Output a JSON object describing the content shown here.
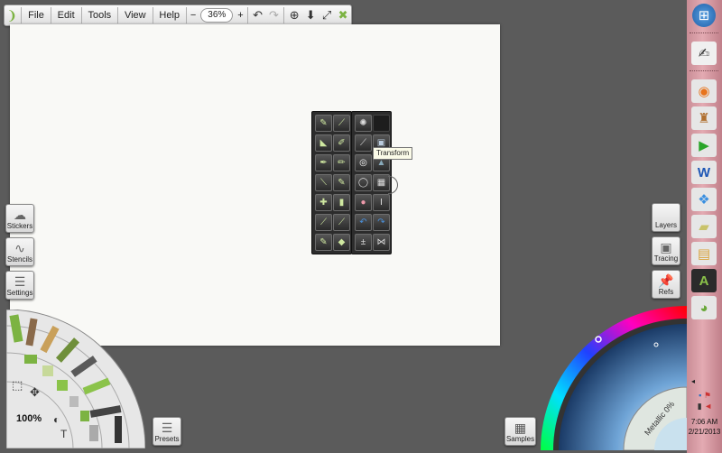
{
  "menubar": {
    "menus": [
      "File",
      "Edit",
      "Tools",
      "View",
      "Help"
    ],
    "zoom_minus": "−",
    "zoom_value": "36%",
    "zoom_plus": "+"
  },
  "tooltip": "Transform",
  "left_buttons": {
    "stickers": "Stickers",
    "stencils": "Stencils",
    "settings": "Settings"
  },
  "right_buttons": {
    "layers": "Layers",
    "tracing": "Tracing",
    "refs": "Refs"
  },
  "brush_zoom": "100%",
  "presets_label": "Presets",
  "samples_label": "Samples",
  "color_picker": {
    "metallic_label": "Metallic 0%"
  },
  "taskbar": {
    "time": "7:06 AM",
    "date": "2/21/2013"
  },
  "colors": {
    "background": "#5b5b5b",
    "canvas": "#f9f9f6",
    "accent": "#8bc34a",
    "taskbar": "#d79ea7"
  }
}
